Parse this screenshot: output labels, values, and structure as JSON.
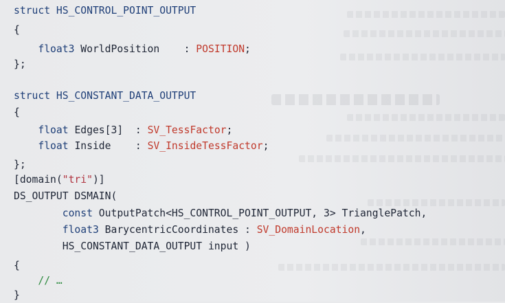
{
  "code": {
    "lines": [
      [
        {
          "text": "struct HS_CONTROL_POINT_OUTPUT",
          "style": "kw"
        }
      ],
      [
        {
          "text": "{",
          "style": "plain"
        }
      ],
      [
        {
          "text": "    float3 ",
          "style": "type"
        },
        {
          "text": "WorldPosition    : ",
          "style": "plain"
        },
        {
          "text": "POSITION",
          "style": "sem"
        },
        {
          "text": ";",
          "style": "plain"
        }
      ],
      [
        {
          "text": "};",
          "style": "plain"
        }
      ],
      [
        {
          "text": "",
          "style": "plain"
        }
      ],
      [
        {
          "text": "struct HS_CONSTANT_DATA_OUTPUT",
          "style": "kw"
        }
      ],
      [
        {
          "text": "{",
          "style": "plain"
        }
      ],
      [
        {
          "text": "    float ",
          "style": "type"
        },
        {
          "text": "Edges[3]  : ",
          "style": "plain"
        },
        {
          "text": "SV_TessFactor",
          "style": "sem"
        },
        {
          "text": ";",
          "style": "plain"
        }
      ],
      [
        {
          "text": "    float ",
          "style": "type"
        },
        {
          "text": "Inside    : ",
          "style": "plain"
        },
        {
          "text": "SV_InsideTessFactor",
          "style": "sem"
        },
        {
          "text": ";",
          "style": "plain"
        }
      ],
      [
        {
          "text": "};",
          "style": "plain"
        }
      ],
      [
        {
          "text": "[domain(",
          "style": "plain"
        },
        {
          "text": "\"tri\"",
          "style": "str"
        },
        {
          "text": ")]",
          "style": "plain"
        }
      ],
      [
        {
          "text": "DS_OUTPUT DSMAIN(",
          "style": "plain"
        }
      ],
      [
        {
          "text": "        const ",
          "style": "kw"
        },
        {
          "text": "OutputPatch<HS_CONTROL_POINT_OUTPUT, 3> TrianglePatch,",
          "style": "plain"
        }
      ],
      [
        {
          "text": "        float3 ",
          "style": "type"
        },
        {
          "text": "BarycentricCoordinates : ",
          "style": "plain"
        },
        {
          "text": "SV_DomainLocation",
          "style": "sem"
        },
        {
          "text": ",",
          "style": "plain"
        }
      ],
      [
        {
          "text": "        HS_CONSTANT_DATA_OUTPUT input )",
          "style": "plain"
        }
      ],
      [
        {
          "text": "{",
          "style": "plain"
        }
      ],
      [
        {
          "text": "    // …",
          "style": "cmt"
        }
      ],
      [
        {
          "text": "}",
          "style": "plain"
        }
      ]
    ]
  },
  "colors": {
    "keyword": "#1f3f78",
    "plain": "#1e2535",
    "semantic": "#c0392b",
    "string": "#b0333f",
    "comment": "#2d8a3e",
    "page": "#e9eaec"
  }
}
